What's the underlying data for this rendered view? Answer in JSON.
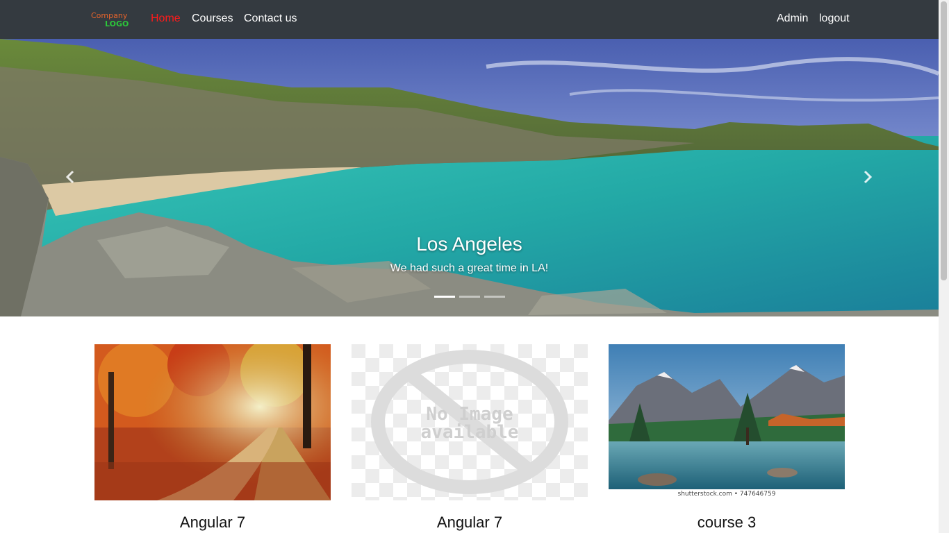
{
  "navbar": {
    "logo": {
      "line1": "Company",
      "line2": "LOGO"
    },
    "links": [
      {
        "label": "Home",
        "active": true
      },
      {
        "label": "Courses",
        "active": false
      },
      {
        "label": "Contact us",
        "active": false
      }
    ],
    "right_links": [
      {
        "label": "Admin"
      },
      {
        "label": "logout"
      }
    ]
  },
  "carousel": {
    "slides": [
      {
        "title": "Los Angeles",
        "text": "We had such a great time in LA!"
      }
    ],
    "indicator_count": 3,
    "active_index": 0,
    "prev_icon": "chevron-left-icon",
    "next_icon": "chevron-right-icon"
  },
  "courses": [
    {
      "title": "Angular 7",
      "image": "autumn-forest-path"
    },
    {
      "title": "Angular 7",
      "image": "no-image-placeholder",
      "placeholder_text": [
        "No Image",
        "available"
      ]
    },
    {
      "title": "course 3",
      "image": "mountain-lake",
      "watermark": "shutterstock.com • 747646759"
    }
  ],
  "colors": {
    "navbar_bg": "#343a40",
    "active_link": "#ff1a1a",
    "sea": "#2fb7ad"
  }
}
